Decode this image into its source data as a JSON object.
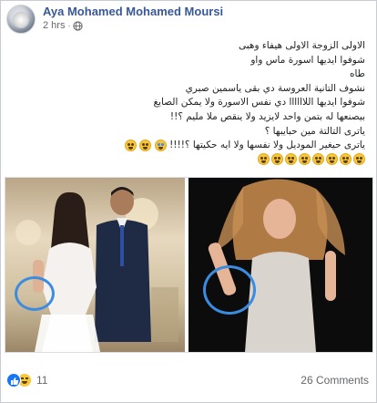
{
  "post": {
    "author": "Aya Mohamed Mohamed Moursi",
    "time": "2 hrs",
    "separator": "·",
    "lines": [
      "الاولى الزوجة الاولى هيفاء وهبى",
      "شوفوا ايديها اسورة ماس واو",
      "طاه",
      "نشوف التانية العروسة دي بقى ياسمين صبري",
      "شوفوا ايديها اللاااااا دي نفس الاسورة ولا يمكن الصايغ",
      "بيصنعها له بتمن واحد لايزيد ولا ينقص ملا مليم ؟!!",
      "ياترى التالتة مين حبايبها ؟",
      "ياترى حيغير الموديل ولا نفسها ولا ايه حكيتها ؟!!!!"
    ],
    "trailing_emojis": [
      "laughing-tear",
      "laughing",
      "laughing"
    ],
    "emoji_row": [
      "laughing",
      "laughing",
      "laughing",
      "laughing",
      "laughing",
      "laughing",
      "laughing",
      "laughing"
    ]
  },
  "photos": {
    "left": {
      "description_icon": "couple-photo"
    },
    "right": {
      "description_icon": "woman-photo"
    },
    "annotation_color": "#3b8be0"
  },
  "footer": {
    "reactions": [
      "like-icon",
      "haha-icon"
    ],
    "reaction_count": "11",
    "comments_label": "26 Comments"
  },
  "colors": {
    "author": "#385898",
    "meta": "#65676b",
    "like": "#1877f2"
  }
}
